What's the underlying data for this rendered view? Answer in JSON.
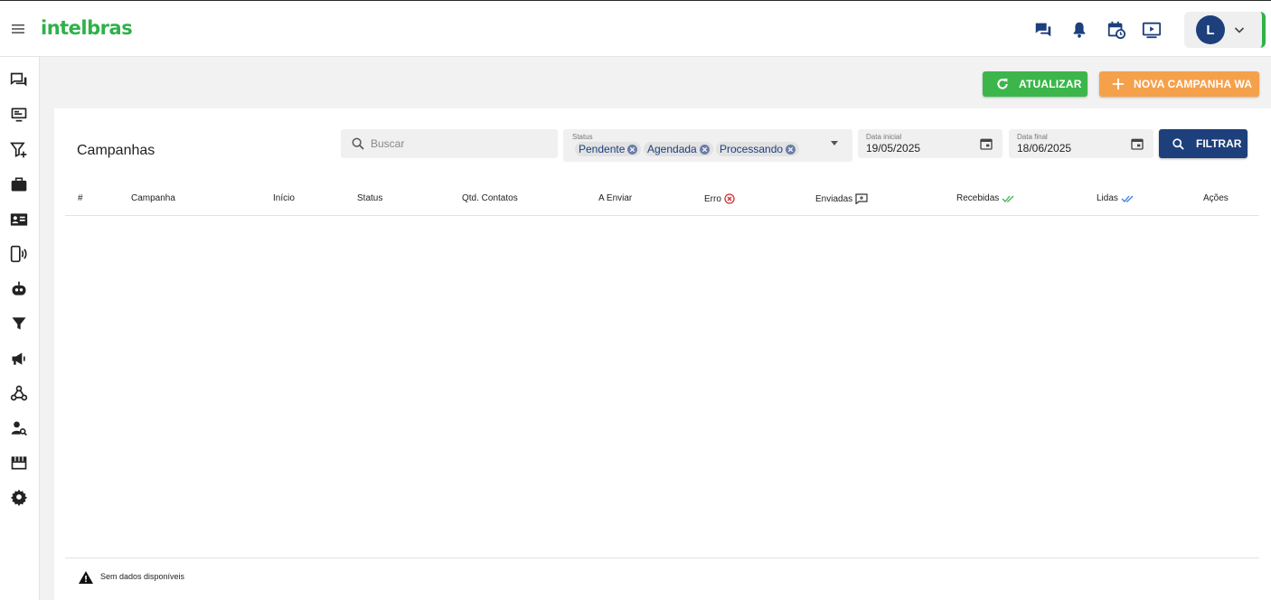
{
  "app": {
    "logo": "intelbras",
    "user_initial": "L"
  },
  "header_icons": [
    "chat-icon",
    "bell-icon",
    "calendar-clock-icon",
    "play-screen-icon"
  ],
  "sidebar_icons": [
    "chats-icon",
    "monitor-icon",
    "filter-add-icon",
    "briefcase-icon",
    "contact-card-icon",
    "phone-broadcast-icon",
    "robot-icon",
    "filter-icon",
    "megaphone-icon",
    "webhook-icon",
    "user-search-icon",
    "storefront-icon",
    "settings-icon"
  ],
  "actions": {
    "refresh_label": "ATUALIZAR",
    "new_campaign_label": "NOVA CAMPANHA WA"
  },
  "page": {
    "title": "Campanhas"
  },
  "filters": {
    "search_placeholder": "Buscar",
    "status_label": "Status",
    "status_chips": [
      "Pendente",
      "Agendada",
      "Processando"
    ],
    "start_date_label": "Data inicial",
    "start_date_value": "19/05/2025",
    "end_date_label": "Data final",
    "end_date_value": "18/06/2025",
    "filter_label": "FILTRAR"
  },
  "table": {
    "columns": [
      "#",
      "Campanha",
      "Início",
      "Status",
      "Qtd. Contatos",
      "A Enviar",
      "Erro",
      "Enviadas",
      "Recebidas",
      "Lidas",
      "Ações"
    ],
    "rows": [],
    "empty_message": "Sem dados disponíveis"
  },
  "colors": {
    "brand_green": "#2fb14a",
    "primary_blue": "#1d3f7c",
    "accent_orange": "#f5a14b",
    "refresh_green": "#3cb64a",
    "error_red": "#d32f2f"
  }
}
